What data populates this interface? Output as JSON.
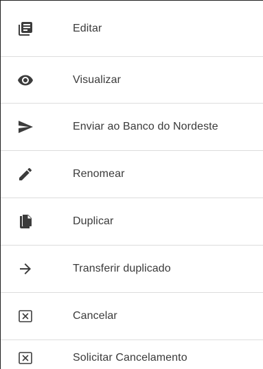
{
  "menu": {
    "items": [
      {
        "label": "Editar",
        "icon": "document-edit-icon"
      },
      {
        "label": "Visualizar",
        "icon": "eye-icon"
      },
      {
        "label": "Enviar ao Banco do Nordeste",
        "icon": "send-icon"
      },
      {
        "label": "Renomear",
        "icon": "pencil-icon"
      },
      {
        "label": "Duplicar",
        "icon": "copy-icon"
      },
      {
        "label": "Transferir duplicado",
        "icon": "arrow-right-icon"
      },
      {
        "label": "Cancelar",
        "icon": "close-box-icon"
      },
      {
        "label": "Solicitar Cancelamento",
        "icon": "close-box-icon"
      }
    ]
  },
  "colors": {
    "icon": "#3c3c3c",
    "text": "#3a3a3a",
    "divider": "#dcdcdc",
    "background": "#ffffff"
  }
}
